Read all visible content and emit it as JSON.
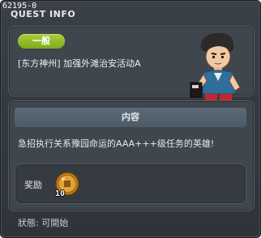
{
  "window": {
    "quest_id": "62195-0",
    "title": "QUEST INFO"
  },
  "quest": {
    "category_badge": "一般",
    "name": "[东方神州] 加强外滩治安活动A"
  },
  "content": {
    "header": "内容",
    "description": "急招执行关系豫园命运的AAA+++级任务的英雄!",
    "reward_label": "奖励",
    "reward_item": {
      "icon": "gold-coin-icon",
      "count": "10"
    }
  },
  "status": {
    "text": "狀態: 可開始"
  },
  "colors": {
    "window_bg": "#33383e",
    "panel_bg": "#40464d",
    "badge_green": "#8fb92a",
    "header_bg": "#52606c"
  }
}
